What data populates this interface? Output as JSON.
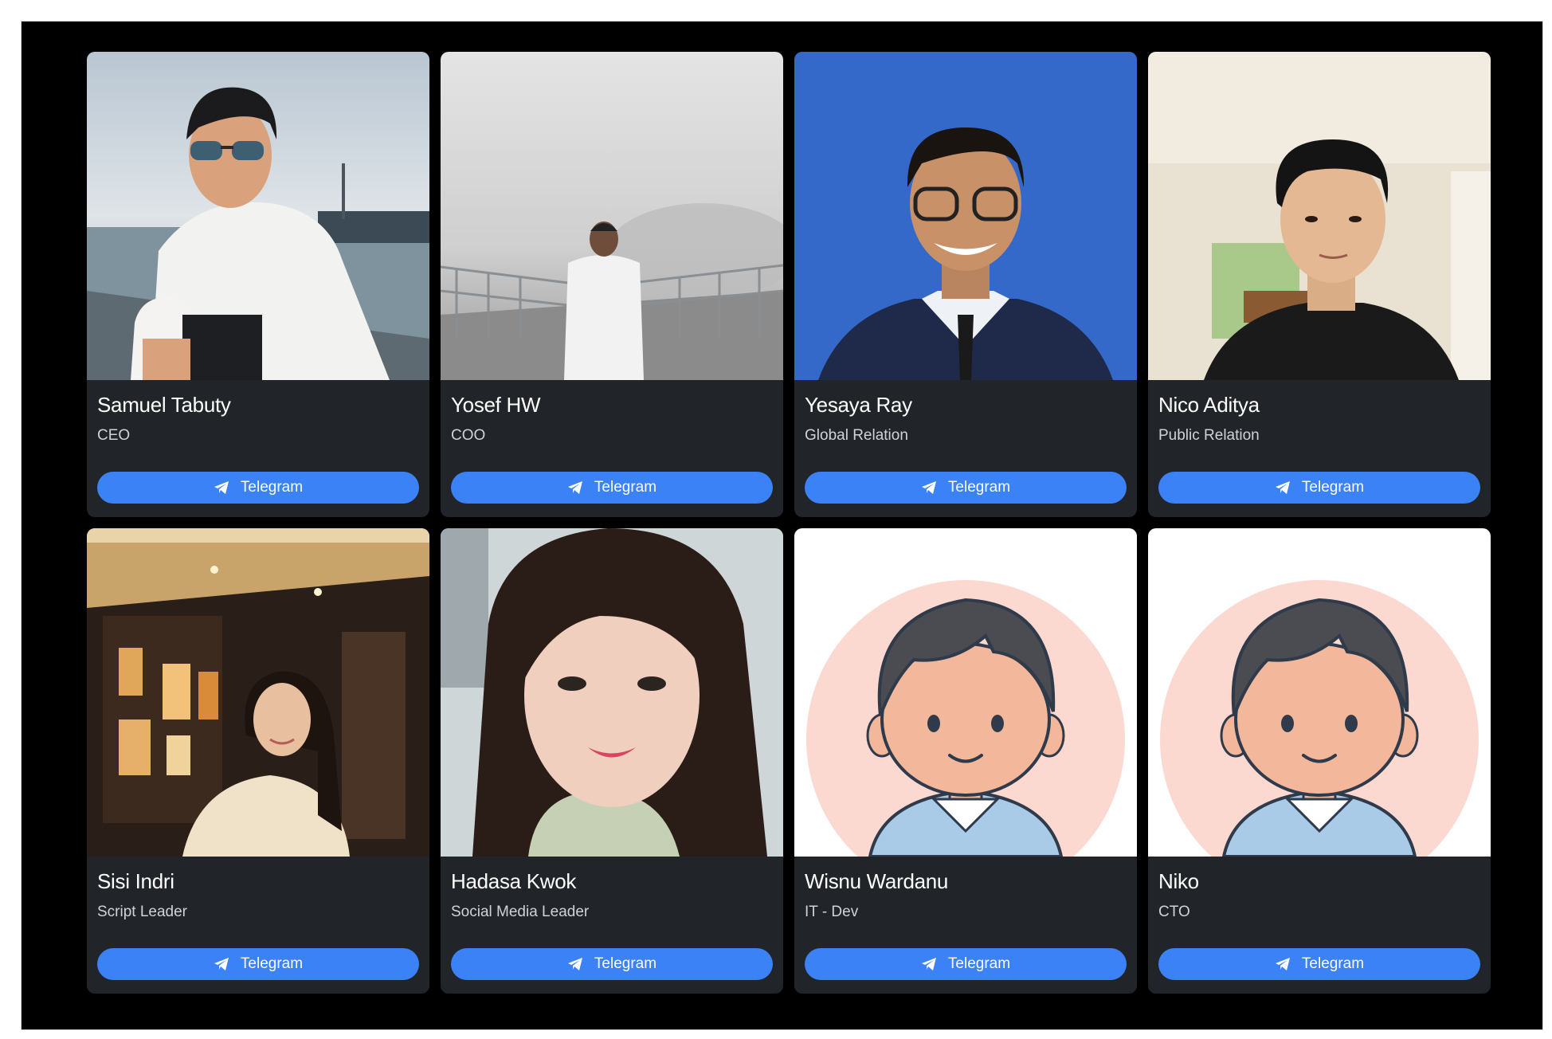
{
  "team": {
    "button_label": "Telegram",
    "button_icon": "telegram-send-icon",
    "accent_color": "#3b82f6",
    "card_background": "#212529",
    "members": [
      {
        "name": "Samuel Tabuty",
        "role": "CEO",
        "photo": "photo-man-sunglasses-boat"
      },
      {
        "name": "Yosef HW",
        "role": "COO",
        "photo": "photo-man-white-coat-foggy-sea"
      },
      {
        "name": "Yesaya Ray",
        "role": "Global Relation",
        "photo": "photo-man-glasses-suit-blue-backdrop"
      },
      {
        "name": "Nico Aditya",
        "role": "Public Relation",
        "photo": "photo-young-man-black-shirt"
      },
      {
        "name": "Sisi Indri",
        "role": "Script Leader",
        "photo": "photo-woman-restaurant"
      },
      {
        "name": "Hadasa Kwok",
        "role": "Social Media Leader",
        "photo": "photo-woman-selfie"
      },
      {
        "name": "Wisnu Wardanu",
        "role": "IT - Dev",
        "photo": "cartoon-avatar-boy"
      },
      {
        "name": "Niko",
        "role": "CTO",
        "photo": "cartoon-avatar-boy"
      }
    ]
  }
}
